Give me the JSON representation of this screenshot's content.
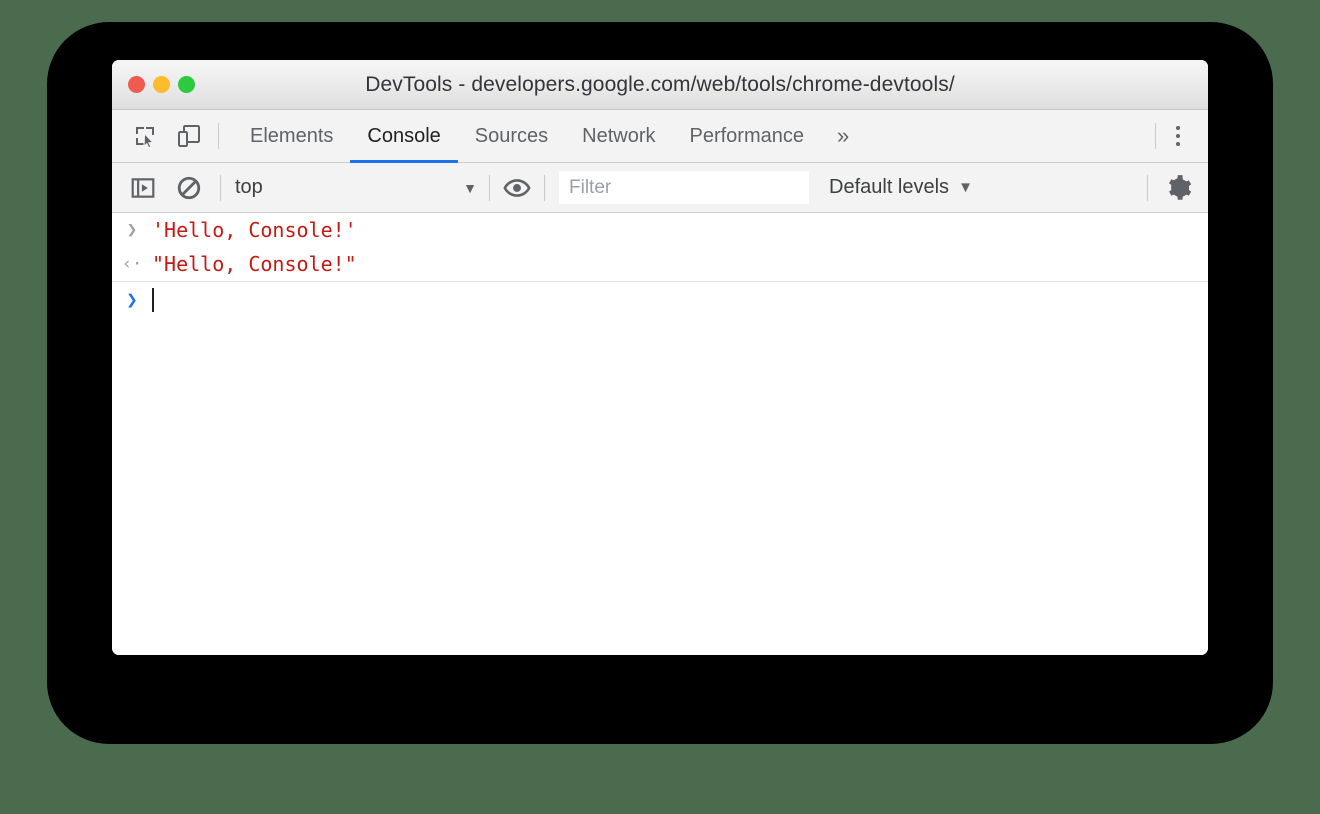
{
  "window": {
    "title": "DevTools - developers.google.com/web/tools/chrome-devtools/",
    "traffic_lights": [
      {
        "name": "close",
        "color": "#ee5b51"
      },
      {
        "name": "minimize",
        "color": "#fcbc2d"
      },
      {
        "name": "maximize",
        "color": "#2dc93f"
      }
    ]
  },
  "tabbar": {
    "icons": [
      {
        "name": "inspect-element-icon"
      },
      {
        "name": "device-toolbar-icon"
      }
    ],
    "tabs": [
      {
        "label": "Elements",
        "active": false
      },
      {
        "label": "Console",
        "active": true
      },
      {
        "label": "Sources",
        "active": false
      },
      {
        "label": "Network",
        "active": false
      },
      {
        "label": "Performance",
        "active": false
      }
    ],
    "overflow_label": "»",
    "menu_icon": "more-vertical-icon",
    "active_underline_color": "#1a73e8"
  },
  "console_toolbar": {
    "sidebar_icon": "show-console-sidebar-icon",
    "clear_icon": "clear-console-icon",
    "context": {
      "value": "top",
      "caret": "▼"
    },
    "eye_icon": "create-live-expression-icon",
    "filter": {
      "value": "",
      "placeholder": "Filter"
    },
    "levels": {
      "label": "Default levels",
      "caret": "▼"
    },
    "settings_icon": "gear-icon"
  },
  "console": {
    "rows": [
      {
        "kind": "input",
        "arrow": "❯",
        "arrow_style": "gray",
        "text": "'Hello, Console!'",
        "color": "#c41a16"
      },
      {
        "kind": "output",
        "arrow": "‹·",
        "arrow_style": "gray",
        "text": "\"Hello, Console!\"",
        "color": "#c41a16"
      }
    ],
    "prompt": {
      "arrow": "❯",
      "arrow_style": "blue",
      "value": ""
    }
  },
  "colors": {
    "page_background": "#4a6b4e",
    "backdrop": "#000000",
    "window_background": "#ffffff",
    "toolbar_background": "#f3f3f3",
    "accent": "#1a73e8",
    "string_literal": "#c41a16"
  }
}
